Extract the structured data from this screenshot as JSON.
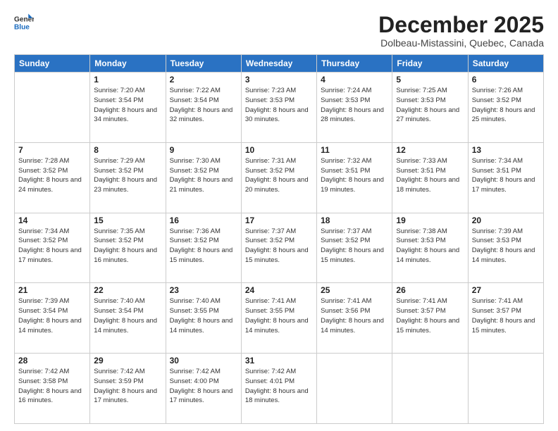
{
  "header": {
    "logo_general": "General",
    "logo_blue": "Blue",
    "month_title": "December 2025",
    "subtitle": "Dolbeau-Mistassini, Quebec, Canada"
  },
  "weekdays": [
    "Sunday",
    "Monday",
    "Tuesday",
    "Wednesday",
    "Thursday",
    "Friday",
    "Saturday"
  ],
  "rows": [
    [
      {
        "day": "",
        "info": ""
      },
      {
        "day": "1",
        "info": "Sunrise: 7:20 AM\nSunset: 3:54 PM\nDaylight: 8 hours\nand 34 minutes."
      },
      {
        "day": "2",
        "info": "Sunrise: 7:22 AM\nSunset: 3:54 PM\nDaylight: 8 hours\nand 32 minutes."
      },
      {
        "day": "3",
        "info": "Sunrise: 7:23 AM\nSunset: 3:53 PM\nDaylight: 8 hours\nand 30 minutes."
      },
      {
        "day": "4",
        "info": "Sunrise: 7:24 AM\nSunset: 3:53 PM\nDaylight: 8 hours\nand 28 minutes."
      },
      {
        "day": "5",
        "info": "Sunrise: 7:25 AM\nSunset: 3:53 PM\nDaylight: 8 hours\nand 27 minutes."
      },
      {
        "day": "6",
        "info": "Sunrise: 7:26 AM\nSunset: 3:52 PM\nDaylight: 8 hours\nand 25 minutes."
      }
    ],
    [
      {
        "day": "7",
        "info": "Sunrise: 7:28 AM\nSunset: 3:52 PM\nDaylight: 8 hours\nand 24 minutes."
      },
      {
        "day": "8",
        "info": "Sunrise: 7:29 AM\nSunset: 3:52 PM\nDaylight: 8 hours\nand 23 minutes."
      },
      {
        "day": "9",
        "info": "Sunrise: 7:30 AM\nSunset: 3:52 PM\nDaylight: 8 hours\nand 21 minutes."
      },
      {
        "day": "10",
        "info": "Sunrise: 7:31 AM\nSunset: 3:52 PM\nDaylight: 8 hours\nand 20 minutes."
      },
      {
        "day": "11",
        "info": "Sunrise: 7:32 AM\nSunset: 3:51 PM\nDaylight: 8 hours\nand 19 minutes."
      },
      {
        "day": "12",
        "info": "Sunrise: 7:33 AM\nSunset: 3:51 PM\nDaylight: 8 hours\nand 18 minutes."
      },
      {
        "day": "13",
        "info": "Sunrise: 7:34 AM\nSunset: 3:51 PM\nDaylight: 8 hours\nand 17 minutes."
      }
    ],
    [
      {
        "day": "14",
        "info": "Sunrise: 7:34 AM\nSunset: 3:52 PM\nDaylight: 8 hours\nand 17 minutes."
      },
      {
        "day": "15",
        "info": "Sunrise: 7:35 AM\nSunset: 3:52 PM\nDaylight: 8 hours\nand 16 minutes."
      },
      {
        "day": "16",
        "info": "Sunrise: 7:36 AM\nSunset: 3:52 PM\nDaylight: 8 hours\nand 15 minutes."
      },
      {
        "day": "17",
        "info": "Sunrise: 7:37 AM\nSunset: 3:52 PM\nDaylight: 8 hours\nand 15 minutes."
      },
      {
        "day": "18",
        "info": "Sunrise: 7:37 AM\nSunset: 3:52 PM\nDaylight: 8 hours\nand 15 minutes."
      },
      {
        "day": "19",
        "info": "Sunrise: 7:38 AM\nSunset: 3:53 PM\nDaylight: 8 hours\nand 14 minutes."
      },
      {
        "day": "20",
        "info": "Sunrise: 7:39 AM\nSunset: 3:53 PM\nDaylight: 8 hours\nand 14 minutes."
      }
    ],
    [
      {
        "day": "21",
        "info": "Sunrise: 7:39 AM\nSunset: 3:54 PM\nDaylight: 8 hours\nand 14 minutes."
      },
      {
        "day": "22",
        "info": "Sunrise: 7:40 AM\nSunset: 3:54 PM\nDaylight: 8 hours\nand 14 minutes."
      },
      {
        "day": "23",
        "info": "Sunrise: 7:40 AM\nSunset: 3:55 PM\nDaylight: 8 hours\nand 14 minutes."
      },
      {
        "day": "24",
        "info": "Sunrise: 7:41 AM\nSunset: 3:55 PM\nDaylight: 8 hours\nand 14 minutes."
      },
      {
        "day": "25",
        "info": "Sunrise: 7:41 AM\nSunset: 3:56 PM\nDaylight: 8 hours\nand 14 minutes."
      },
      {
        "day": "26",
        "info": "Sunrise: 7:41 AM\nSunset: 3:57 PM\nDaylight: 8 hours\nand 15 minutes."
      },
      {
        "day": "27",
        "info": "Sunrise: 7:41 AM\nSunset: 3:57 PM\nDaylight: 8 hours\nand 15 minutes."
      }
    ],
    [
      {
        "day": "28",
        "info": "Sunrise: 7:42 AM\nSunset: 3:58 PM\nDaylight: 8 hours\nand 16 minutes."
      },
      {
        "day": "29",
        "info": "Sunrise: 7:42 AM\nSunset: 3:59 PM\nDaylight: 8 hours\nand 17 minutes."
      },
      {
        "day": "30",
        "info": "Sunrise: 7:42 AM\nSunset: 4:00 PM\nDaylight: 8 hours\nand 17 minutes."
      },
      {
        "day": "31",
        "info": "Sunrise: 7:42 AM\nSunset: 4:01 PM\nDaylight: 8 hours\nand 18 minutes."
      },
      {
        "day": "",
        "info": ""
      },
      {
        "day": "",
        "info": ""
      },
      {
        "day": "",
        "info": ""
      }
    ]
  ]
}
